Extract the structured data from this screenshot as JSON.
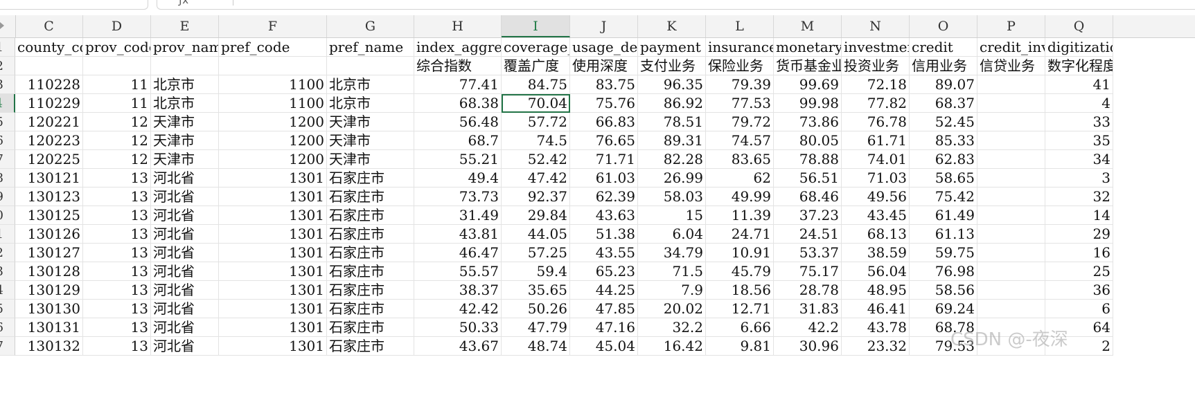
{
  "watermark": "CSDN @-夜深",
  "spreadsheet": {
    "columns": [
      "C",
      "D",
      "E",
      "F",
      "G",
      "H",
      "I",
      "J",
      "K",
      "L",
      "M",
      "N",
      "O",
      "P",
      "Q"
    ],
    "selected_column": "I",
    "selected_row": "4",
    "row_numbers": [
      "1",
      "2",
      "3",
      "4",
      "5",
      "6",
      "7",
      "8",
      "9",
      "0",
      "1",
      "2",
      "3",
      "4",
      "5",
      "6",
      "7"
    ],
    "rows": [
      [
        "county_code",
        "prov_code",
        "prov_name",
        "pref_code",
        "pref_name",
        "index_aggregate",
        "coverage_breadth",
        "usage_depth",
        "payment",
        "insurance",
        "monetary_fund",
        "investment",
        "credit",
        "credit_investigation",
        "digitization_level"
      ],
      [
        "",
        "",
        "",
        "",
        "",
        "综合指数",
        "覆盖广度",
        "使用深度",
        "支付业务",
        "保险业务",
        "货币基金业务",
        "投资业务",
        "信用业务",
        "信贷业务",
        "数字化程度"
      ],
      [
        "110228",
        "11",
        "北京市",
        "1100",
        "北京市",
        "77.41",
        "84.75",
        "83.75",
        "96.35",
        "79.39",
        "99.69",
        "72.18",
        "89.07",
        "",
        "41"
      ],
      [
        "110229",
        "11",
        "北京市",
        "1100",
        "北京市",
        "68.38",
        "70.04",
        "75.76",
        "86.92",
        "77.53",
        "99.98",
        "77.82",
        "68.37",
        "",
        "4"
      ],
      [
        "120221",
        "12",
        "天津市",
        "1200",
        "天津市",
        "56.48",
        "57.72",
        "66.83",
        "78.51",
        "79.72",
        "73.86",
        "76.78",
        "52.45",
        "",
        "33"
      ],
      [
        "120223",
        "12",
        "天津市",
        "1200",
        "天津市",
        "68.7",
        "74.5",
        "76.65",
        "89.31",
        "74.57",
        "80.05",
        "61.71",
        "85.33",
        "",
        "35"
      ],
      [
        "120225",
        "12",
        "天津市",
        "1200",
        "天津市",
        "55.21",
        "52.42",
        "71.71",
        "82.28",
        "83.65",
        "78.88",
        "74.01",
        "62.83",
        "",
        "34"
      ],
      [
        "130121",
        "13",
        "河北省",
        "1301",
        "石家庄市",
        "49.4",
        "47.42",
        "61.03",
        "26.99",
        "62",
        "56.51",
        "71.03",
        "58.65",
        "",
        "3"
      ],
      [
        "130123",
        "13",
        "河北省",
        "1301",
        "石家庄市",
        "73.73",
        "92.37",
        "62.39",
        "58.03",
        "49.99",
        "68.46",
        "49.56",
        "75.42",
        "",
        "32"
      ],
      [
        "130125",
        "13",
        "河北省",
        "1301",
        "石家庄市",
        "31.49",
        "29.84",
        "43.63",
        "15",
        "11.39",
        "37.23",
        "43.45",
        "61.49",
        "",
        "14"
      ],
      [
        "130126",
        "13",
        "河北省",
        "1301",
        "石家庄市",
        "43.81",
        "44.05",
        "51.38",
        "6.04",
        "24.71",
        "24.51",
        "68.13",
        "61.13",
        "",
        "29"
      ],
      [
        "130127",
        "13",
        "河北省",
        "1301",
        "石家庄市",
        "46.47",
        "57.25",
        "43.55",
        "34.79",
        "10.91",
        "53.37",
        "38.59",
        "59.75",
        "",
        "16"
      ],
      [
        "130128",
        "13",
        "河北省",
        "1301",
        "石家庄市",
        "55.57",
        "59.4",
        "65.23",
        "71.5",
        "45.79",
        "75.17",
        "56.04",
        "76.98",
        "",
        "25"
      ],
      [
        "130129",
        "13",
        "河北省",
        "1301",
        "石家庄市",
        "38.37",
        "35.65",
        "44.25",
        "7.9",
        "18.56",
        "28.78",
        "48.95",
        "58.56",
        "",
        "36"
      ],
      [
        "130130",
        "13",
        "河北省",
        "1301",
        "石家庄市",
        "42.42",
        "50.26",
        "47.85",
        "20.02",
        "12.71",
        "31.83",
        "46.41",
        "69.24",
        "",
        "6"
      ],
      [
        "130131",
        "13",
        "河北省",
        "1301",
        "石家庄市",
        "50.33",
        "47.79",
        "47.16",
        "32.2",
        "6.66",
        "42.2",
        "43.78",
        "68.78",
        "",
        "64"
      ],
      [
        "130132",
        "13",
        "河北省",
        "1301",
        "石家庄市",
        "43.67",
        "48.74",
        "45.04",
        "16.42",
        "9.81",
        "30.96",
        "23.32",
        "79.53",
        "",
        "2"
      ]
    ]
  }
}
